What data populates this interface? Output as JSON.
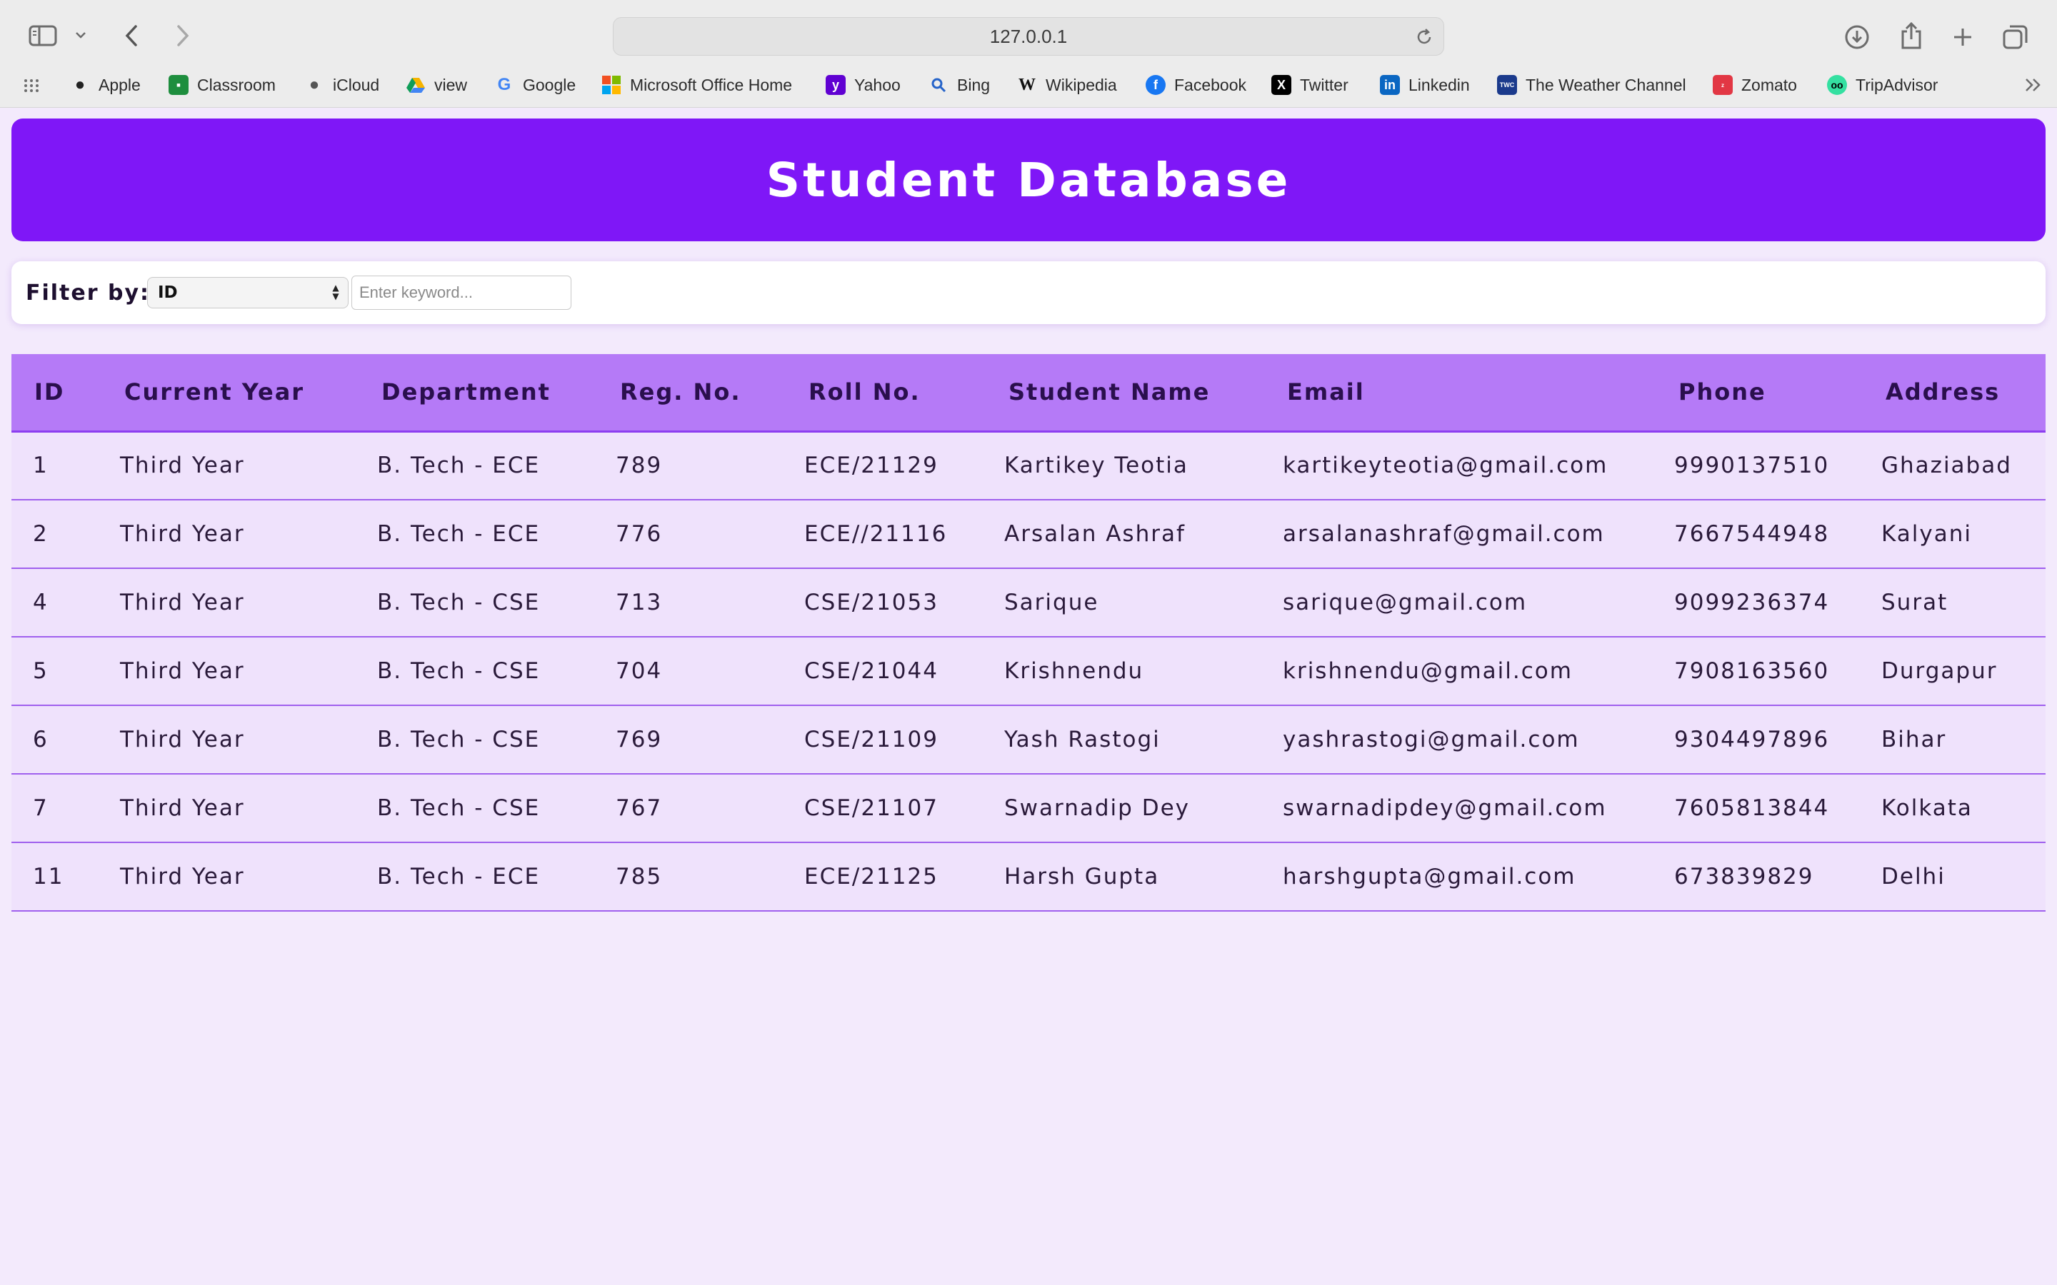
{
  "browser": {
    "url": "127.0.0.1",
    "bookmarks": [
      {
        "label": "Apple",
        "icon": "apple-icon"
      },
      {
        "label": "Classroom",
        "icon": "classroom-icon"
      },
      {
        "label": "iCloud",
        "icon": "icloud-icon"
      },
      {
        "label": "view",
        "icon": "google-drive-icon"
      },
      {
        "label": "Google",
        "icon": "google-icon"
      },
      {
        "label": "Microsoft Office Home",
        "icon": "microsoft-icon"
      },
      {
        "label": "Yahoo",
        "icon": "yahoo-icon"
      },
      {
        "label": "Bing",
        "icon": "bing-search-icon"
      },
      {
        "label": "Wikipedia",
        "icon": "wikipedia-icon"
      },
      {
        "label": "Facebook",
        "icon": "facebook-icon"
      },
      {
        "label": "Twitter",
        "icon": "x-twitter-icon"
      },
      {
        "label": "Linkedin",
        "icon": "linkedin-icon"
      },
      {
        "label": "The Weather Channel",
        "icon": "weather-channel-icon"
      },
      {
        "label": "Zomato",
        "icon": "zomato-icon"
      },
      {
        "label": "TripAdvisor",
        "icon": "tripadvisor-icon"
      }
    ]
  },
  "page": {
    "title": "Student Database",
    "filter_label": "Filter by:",
    "filter_selected": "ID",
    "search_placeholder": "Enter keyword..."
  },
  "table": {
    "headers": [
      "ID",
      "Current Year",
      "Department",
      "Reg. No.",
      "Roll No.",
      "Student Name",
      "Email",
      "Phone",
      "Address"
    ],
    "rows": [
      [
        "1",
        "Third Year",
        "B. Tech - ECE",
        "789",
        "ECE/21129",
        "Kartikey Teotia",
        "kartikeyteotia@gmail.com",
        "9990137510",
        "Ghaziabad"
      ],
      [
        "2",
        "Third Year",
        "B. Tech - ECE",
        "776",
        "ECE//21116",
        "Arsalan Ashraf",
        "arsalanashraf@gmail.com",
        "7667544948",
        "Kalyani"
      ],
      [
        "4",
        "Third Year",
        "B. Tech - CSE",
        "713",
        "CSE/21053",
        "Sarique",
        "sarique@gmail.com",
        "9099236374",
        "Surat"
      ],
      [
        "5",
        "Third Year",
        "B. Tech - CSE",
        "704",
        "CSE/21044",
        "Krishnendu",
        "krishnendu@gmail.com",
        "7908163560",
        "Durgapur"
      ],
      [
        "6",
        "Third Year",
        "B. Tech - CSE",
        "769",
        "CSE/21109",
        "Yash Rastogi",
        "yashrastogi@gmail.com",
        "9304497896",
        "Bihar"
      ],
      [
        "7",
        "Third Year",
        "B. Tech - CSE",
        "767",
        "CSE/21107",
        "Swarnadip Dey",
        "swarnadipdey@gmail.com",
        "7605813844",
        "Kolkata"
      ],
      [
        "11",
        "Third Year",
        "B. Tech - ECE",
        "785",
        "ECE/21125",
        "Harsh Gupta",
        "harshgupta@gmail.com",
        "673839829",
        "Delhi"
      ]
    ]
  },
  "colors": {
    "header_bg": "#7f17f7",
    "table_header_bg": "#b57af7",
    "row_bg": "#efe2fc",
    "page_bg": "#f3eafc"
  }
}
